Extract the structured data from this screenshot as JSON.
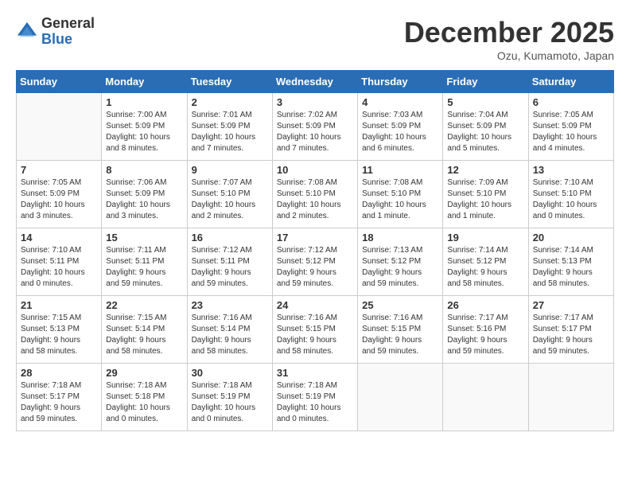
{
  "header": {
    "logo_general": "General",
    "logo_blue": "Blue",
    "month_title": "December 2025",
    "location": "Ozu, Kumamoto, Japan"
  },
  "days_of_week": [
    "Sunday",
    "Monday",
    "Tuesday",
    "Wednesday",
    "Thursday",
    "Friday",
    "Saturday"
  ],
  "weeks": [
    [
      {
        "day": "",
        "info": ""
      },
      {
        "day": "1",
        "info": "Sunrise: 7:00 AM\nSunset: 5:09 PM\nDaylight: 10 hours\nand 8 minutes."
      },
      {
        "day": "2",
        "info": "Sunrise: 7:01 AM\nSunset: 5:09 PM\nDaylight: 10 hours\nand 7 minutes."
      },
      {
        "day": "3",
        "info": "Sunrise: 7:02 AM\nSunset: 5:09 PM\nDaylight: 10 hours\nand 7 minutes."
      },
      {
        "day": "4",
        "info": "Sunrise: 7:03 AM\nSunset: 5:09 PM\nDaylight: 10 hours\nand 6 minutes."
      },
      {
        "day": "5",
        "info": "Sunrise: 7:04 AM\nSunset: 5:09 PM\nDaylight: 10 hours\nand 5 minutes."
      },
      {
        "day": "6",
        "info": "Sunrise: 7:05 AM\nSunset: 5:09 PM\nDaylight: 10 hours\nand 4 minutes."
      }
    ],
    [
      {
        "day": "7",
        "info": "Sunrise: 7:05 AM\nSunset: 5:09 PM\nDaylight: 10 hours\nand 3 minutes."
      },
      {
        "day": "8",
        "info": "Sunrise: 7:06 AM\nSunset: 5:09 PM\nDaylight: 10 hours\nand 3 minutes."
      },
      {
        "day": "9",
        "info": "Sunrise: 7:07 AM\nSunset: 5:10 PM\nDaylight: 10 hours\nand 2 minutes."
      },
      {
        "day": "10",
        "info": "Sunrise: 7:08 AM\nSunset: 5:10 PM\nDaylight: 10 hours\nand 2 minutes."
      },
      {
        "day": "11",
        "info": "Sunrise: 7:08 AM\nSunset: 5:10 PM\nDaylight: 10 hours\nand 1 minute."
      },
      {
        "day": "12",
        "info": "Sunrise: 7:09 AM\nSunset: 5:10 PM\nDaylight: 10 hours\nand 1 minute."
      },
      {
        "day": "13",
        "info": "Sunrise: 7:10 AM\nSunset: 5:10 PM\nDaylight: 10 hours\nand 0 minutes."
      }
    ],
    [
      {
        "day": "14",
        "info": "Sunrise: 7:10 AM\nSunset: 5:11 PM\nDaylight: 10 hours\nand 0 minutes."
      },
      {
        "day": "15",
        "info": "Sunrise: 7:11 AM\nSunset: 5:11 PM\nDaylight: 9 hours\nand 59 minutes."
      },
      {
        "day": "16",
        "info": "Sunrise: 7:12 AM\nSunset: 5:11 PM\nDaylight: 9 hours\nand 59 minutes."
      },
      {
        "day": "17",
        "info": "Sunrise: 7:12 AM\nSunset: 5:12 PM\nDaylight: 9 hours\nand 59 minutes."
      },
      {
        "day": "18",
        "info": "Sunrise: 7:13 AM\nSunset: 5:12 PM\nDaylight: 9 hours\nand 59 minutes."
      },
      {
        "day": "19",
        "info": "Sunrise: 7:14 AM\nSunset: 5:12 PM\nDaylight: 9 hours\nand 58 minutes."
      },
      {
        "day": "20",
        "info": "Sunrise: 7:14 AM\nSunset: 5:13 PM\nDaylight: 9 hours\nand 58 minutes."
      }
    ],
    [
      {
        "day": "21",
        "info": "Sunrise: 7:15 AM\nSunset: 5:13 PM\nDaylight: 9 hours\nand 58 minutes."
      },
      {
        "day": "22",
        "info": "Sunrise: 7:15 AM\nSunset: 5:14 PM\nDaylight: 9 hours\nand 58 minutes."
      },
      {
        "day": "23",
        "info": "Sunrise: 7:16 AM\nSunset: 5:14 PM\nDaylight: 9 hours\nand 58 minutes."
      },
      {
        "day": "24",
        "info": "Sunrise: 7:16 AM\nSunset: 5:15 PM\nDaylight: 9 hours\nand 58 minutes."
      },
      {
        "day": "25",
        "info": "Sunrise: 7:16 AM\nSunset: 5:15 PM\nDaylight: 9 hours\nand 59 minutes."
      },
      {
        "day": "26",
        "info": "Sunrise: 7:17 AM\nSunset: 5:16 PM\nDaylight: 9 hours\nand 59 minutes."
      },
      {
        "day": "27",
        "info": "Sunrise: 7:17 AM\nSunset: 5:17 PM\nDaylight: 9 hours\nand 59 minutes."
      }
    ],
    [
      {
        "day": "28",
        "info": "Sunrise: 7:18 AM\nSunset: 5:17 PM\nDaylight: 9 hours\nand 59 minutes."
      },
      {
        "day": "29",
        "info": "Sunrise: 7:18 AM\nSunset: 5:18 PM\nDaylight: 10 hours\nand 0 minutes."
      },
      {
        "day": "30",
        "info": "Sunrise: 7:18 AM\nSunset: 5:19 PM\nDaylight: 10 hours\nand 0 minutes."
      },
      {
        "day": "31",
        "info": "Sunrise: 7:18 AM\nSunset: 5:19 PM\nDaylight: 10 hours\nand 0 minutes."
      },
      {
        "day": "",
        "info": ""
      },
      {
        "day": "",
        "info": ""
      },
      {
        "day": "",
        "info": ""
      }
    ]
  ]
}
